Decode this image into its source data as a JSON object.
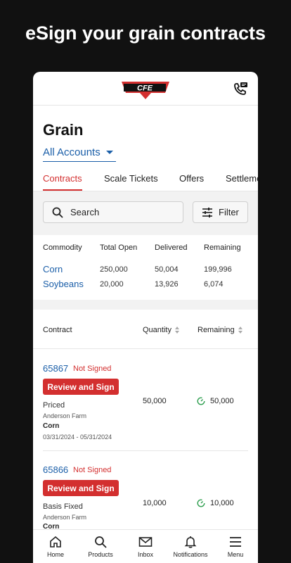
{
  "promo": {
    "headline": "eSign your grain contracts"
  },
  "header": {
    "logo_text": "CFE"
  },
  "page": {
    "title": "Grain",
    "account_selector": "All Accounts"
  },
  "tabs": [
    {
      "label": "Contracts",
      "active": true
    },
    {
      "label": "Scale Tickets",
      "active": false
    },
    {
      "label": "Offers",
      "active": false
    },
    {
      "label": "Settlements",
      "active": false
    }
  ],
  "search": {
    "placeholder": "Search",
    "filter_label": "Filter"
  },
  "summary": {
    "headers": [
      "Commodity",
      "Total Open",
      "Delivered",
      "Remaining"
    ],
    "rows": [
      {
        "commodity": "Corn",
        "total_open": "250,000",
        "delivered": "50,004",
        "remaining": "199,996"
      },
      {
        "commodity": "Soybeans",
        "total_open": "20,000",
        "delivered": "13,926",
        "remaining": "6,074"
      }
    ]
  },
  "contracts_table": {
    "headers": {
      "contract": "Contract",
      "quantity": "Quantity",
      "remaining": "Remaining"
    },
    "rows": [
      {
        "id": "65867",
        "status": "Not Signed",
        "action": "Review and Sign",
        "type": "Priced",
        "farm": "Anderson Farm",
        "commodity": "Corn",
        "dates": "03/31/2024 - 05/31/2024",
        "quantity": "50,000",
        "remaining": "50,000"
      },
      {
        "id": "65866",
        "status": "Not Signed",
        "action": "Review and Sign",
        "type": "Basis Fixed",
        "farm": "Anderson Farm",
        "commodity": "Corn",
        "dates": "",
        "quantity": "10,000",
        "remaining": "10,000"
      }
    ]
  },
  "bottom_nav": [
    {
      "label": "Home",
      "icon": "home-icon"
    },
    {
      "label": "Products",
      "icon": "search-icon"
    },
    {
      "label": "Inbox",
      "icon": "mail-icon"
    },
    {
      "label": "Notifications",
      "icon": "bell-icon"
    },
    {
      "label": "Menu",
      "icon": "menu-icon"
    }
  ],
  "colors": {
    "brand_red": "#d32f2f",
    "link_blue": "#1a5ea8",
    "success_green": "#2e9e4f",
    "background": "#111111"
  }
}
